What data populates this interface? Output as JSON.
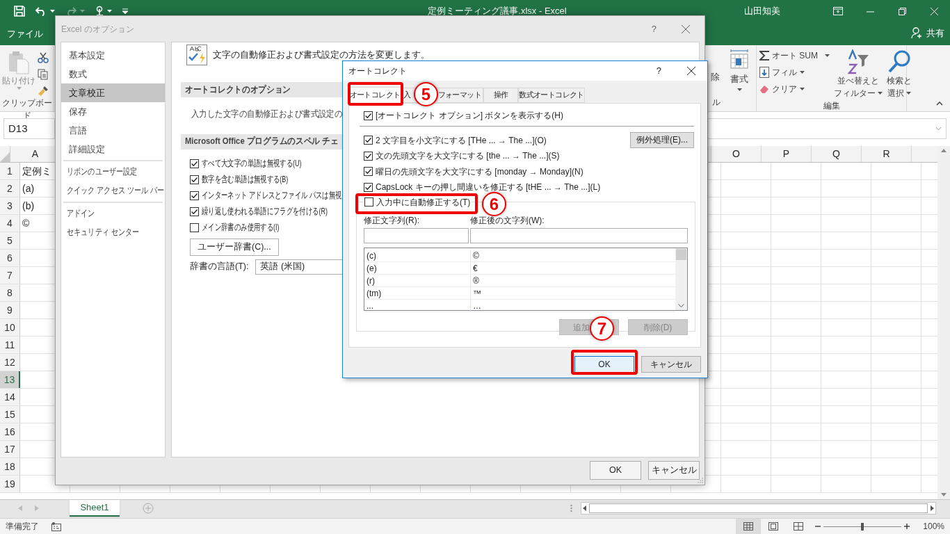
{
  "window": {
    "title": "定例ミーティング議事.xlsx - Excel",
    "user": "山田知美"
  },
  "file_tab": "ファイル",
  "share": "共有",
  "ribbon": {
    "paste": "貼り付け",
    "clipboard_label": "クリップボード",
    "delete": "除",
    "format": "書式",
    "cells_label": "ル",
    "autosum": "オート SUM",
    "fill": "フィル",
    "clear": "クリア",
    "sort": [
      "並べ替えと",
      "フィルター"
    ],
    "find": [
      "検索と",
      "選択"
    ],
    "editing_label": "編集"
  },
  "name_box": "D13",
  "columns": [
    "A",
    "O",
    "P",
    "Q",
    "R"
  ],
  "rows": [
    {
      "header": "1",
      "selected": false,
      "cell": "定例ミ"
    },
    {
      "header": "2",
      "selected": false,
      "cell": "(a)"
    },
    {
      "header": "3",
      "selected": false,
      "cell": "(b)"
    },
    {
      "header": "4",
      "selected": false,
      "cell": "©"
    },
    {
      "header": "5",
      "selected": false
    },
    {
      "header": "6",
      "selected": false
    },
    {
      "header": "7",
      "selected": false
    },
    {
      "header": "8",
      "selected": false
    },
    {
      "header": "9",
      "selected": false
    },
    {
      "header": "10",
      "selected": false
    },
    {
      "header": "11",
      "selected": false
    },
    {
      "header": "12",
      "selected": false
    },
    {
      "header": "13",
      "selected": true
    },
    {
      "header": "14",
      "selected": false
    },
    {
      "header": "15",
      "selected": false
    },
    {
      "header": "16",
      "selected": false
    },
    {
      "header": "17",
      "selected": false
    },
    {
      "header": "18",
      "selected": false
    },
    {
      "header": "19",
      "selected": false
    }
  ],
  "sheet_tabs": [
    {
      "label": "Sheet1",
      "selected": true
    }
  ],
  "status_bar": {
    "text": "準備完了",
    "zoom": "100%",
    "zoom_slider": {
      "level": 0.5
    }
  },
  "options_dialog": {
    "title": "Excel のオプション",
    "help": "?",
    "nav_groups": [
      {
        "items": [
          {
            "label": "基本設定",
            "selected": false
          },
          {
            "label": "数式",
            "selected": false
          },
          {
            "label": "文章校正",
            "selected": true
          },
          {
            "label": "保存",
            "selected": false
          },
          {
            "label": "言語",
            "selected": false
          },
          {
            "label": "詳細設定",
            "selected": false
          }
        ]
      },
      {
        "items": [
          {
            "label": "リボンのユーザー設定",
            "selected": false
          },
          {
            "label": "クイック アクセス ツール バー",
            "selected": false
          }
        ]
      },
      {
        "items": [
          {
            "label": "アドイン",
            "selected": false
          },
          {
            "label": "セキュリティ センター",
            "selected": false
          }
        ]
      }
    ],
    "heading": "文字の自動修正および書式設定の方法を変更します。",
    "autocorrect_section": {
      "title": "オートコレクトのオプション",
      "description": "入力した文字の自動修正および書式設定の"
    },
    "spelling_section": {
      "title": "Microsoft Office プログラムのスペル チェ",
      "options": [
        {
          "label": "すべて大文字の単語は無視する(U)",
          "checked": true
        },
        {
          "label": "数字を含む単語は無視する(B)",
          "checked": true
        },
        {
          "label": "インターネット アドレスとファイル パスは無視",
          "checked": true
        },
        {
          "label": "繰り返し使われる単語にフラグを付ける(R)",
          "checked": true
        },
        {
          "label": "メイン辞書のみ使用する(I)",
          "checked": false
        }
      ],
      "button": "ユーザー辞書(C)...",
      "language_label": "辞書の言語(T):",
      "language": "英語 (米国)"
    },
    "buttons": [
      "OK",
      "キャンセル"
    ]
  },
  "autocorrect_dialog": {
    "title": "オートコレクト",
    "help": "?",
    "tabs": [
      {
        "label": "オートコレクト",
        "selected": true
      },
      {
        "label": [
          "入",
          "フォーマット"
        ],
        "selected": false
      },
      {
        "label": "操作",
        "selected": false
      },
      {
        "label": "数式オートコレクト",
        "selected": false
      }
    ],
    "show_options_button": {
      "label": "[オートコレクト オプション] ボタンを表示する(H)",
      "checked": true
    },
    "options": [
      {
        "label": "2 文字目を小文字にする [THe ... → The ...](O)",
        "checked": true
      },
      {
        "label": "文の先頭文字を大文字にする [the ... → The ...](S)",
        "checked": true
      },
      {
        "label": "曜日の先頭文字を大文字にする [monday → Monday](N)",
        "checked": true
      },
      {
        "label": "CapsLock キーの押し間違いを修正する [tHE ... → The ...](L)",
        "checked": true
      }
    ],
    "exceptions_button": "例外処理(E)...",
    "replace_as_you_type": {
      "label": "入力中に自動修正する(T)",
      "checked": false
    },
    "replace_label": "修正文字列(R):",
    "with_label": "修正後の文字列(W):",
    "entries": [
      {
        "replace": "(c)",
        "with": "©"
      },
      {
        "replace": "(e)",
        "with": "€"
      },
      {
        "replace": "(r)",
        "with": "®"
      },
      {
        "replace": "(tm)",
        "with": "™"
      },
      {
        "replace": "...",
        "with": "…"
      }
    ],
    "list_buttons": [
      {
        "label": "追加",
        "disabled": true
      },
      {
        "label": "削除(D)",
        "disabled": true
      }
    ],
    "buttons": [
      {
        "label": "OK",
        "default": true
      },
      {
        "label": "キャンセル",
        "default": false
      }
    ]
  },
  "annotations": [
    {
      "number": "5"
    },
    {
      "number": "6"
    },
    {
      "number": "7"
    }
  ]
}
